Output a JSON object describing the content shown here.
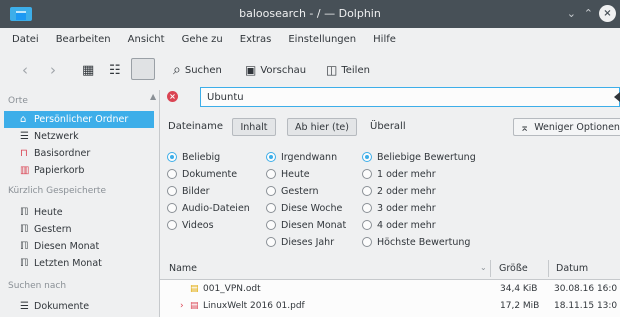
{
  "window": {
    "title": "baloosearch - / — Dolphin",
    "controls": {
      "minimize": "⌄",
      "maximize": "⌃",
      "close": "×"
    }
  },
  "menu": [
    "Datei",
    "Bearbeiten",
    "Ansicht",
    "Gehe zu",
    "Extras",
    "Einstellungen",
    "Hilfe"
  ],
  "toolbar": {
    "back_icon": "back-arrow-icon",
    "forward_icon": "forward-arrow-icon",
    "search_label": "Suchen",
    "preview_label": "Vorschau",
    "split_label": "Teilen"
  },
  "sidebar": {
    "places_header": "Orte",
    "places": [
      {
        "label": "Persönlicher Ordner",
        "icon": "home-icon",
        "active": true
      },
      {
        "label": "Netzwerk",
        "icon": "network-icon"
      },
      {
        "label": "Basisordner",
        "icon": "root-folder-icon"
      },
      {
        "label": "Papierkorb",
        "icon": "trash-icon"
      }
    ],
    "recent_header": "Kürzlich Gespeicherte",
    "recent": [
      {
        "label": "Heute",
        "icon": "calendar-icon"
      },
      {
        "label": "Gestern",
        "icon": "calendar-icon"
      },
      {
        "label": "Diesen Monat",
        "icon": "calendar-icon"
      },
      {
        "label": "Letzten Monat",
        "icon": "calendar-icon"
      }
    ],
    "search_header": "Suchen nach",
    "search_for": [
      {
        "label": "Dokumente",
        "icon": "documents-icon"
      }
    ]
  },
  "search": {
    "value": "Ubuntu"
  },
  "facets": {
    "filename_label": "Dateiname",
    "content_label": "Inhalt",
    "from_here_label": "Ab hier (te)",
    "everywhere_label": "Überall",
    "fewer_options_label": "Weniger Optionen"
  },
  "type_options": [
    {
      "label": "Beliebig",
      "selected": true
    },
    {
      "label": "Dokumente"
    },
    {
      "label": "Bilder"
    },
    {
      "label": "Audio-Dateien"
    },
    {
      "label": "Videos"
    }
  ],
  "date_options": [
    {
      "label": "Irgendwann",
      "selected": true
    },
    {
      "label": "Heute"
    },
    {
      "label": "Gestern"
    },
    {
      "label": "Diese Woche"
    },
    {
      "label": "Diesen Monat"
    },
    {
      "label": "Dieses Jahr"
    }
  ],
  "rating_options": [
    {
      "label": "Beliebige Bewertung",
      "selected": true
    },
    {
      "label": "1 oder mehr"
    },
    {
      "label": "2 oder mehr"
    },
    {
      "label": "3 oder mehr"
    },
    {
      "label": "4 oder mehr"
    },
    {
      "label": "Höchste Bewertung"
    }
  ],
  "file_list": {
    "columns": {
      "name": "Name",
      "size": "Größe",
      "date": "Datum"
    },
    "rows": [
      {
        "name": "001_VPN.odt",
        "size": "34,4 KiB",
        "date": "30.08.16 16:0"
      },
      {
        "name": "LinuxWelt 2016 01.pdf",
        "size": "17,2 MiB",
        "date": "18.11.15 13:0"
      }
    ]
  },
  "colors": {
    "accent": "#3daee9",
    "titlebar": "#475057",
    "warning": "#da4453"
  }
}
